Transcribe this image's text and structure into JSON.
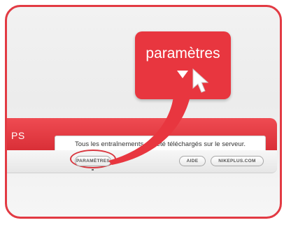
{
  "app": {
    "title": "PS",
    "status_message": "Tous les entraînements ont été téléchargés sur le serveur."
  },
  "footer": {
    "params_label": "PARAMÈTRES",
    "help_label": "AIDE",
    "nikeplus_label": "NIKEPLUS.COM"
  },
  "callout": {
    "label": "paramètres"
  },
  "colors": {
    "brand_red": "#e8363f",
    "frame_red": "#e23a43"
  }
}
